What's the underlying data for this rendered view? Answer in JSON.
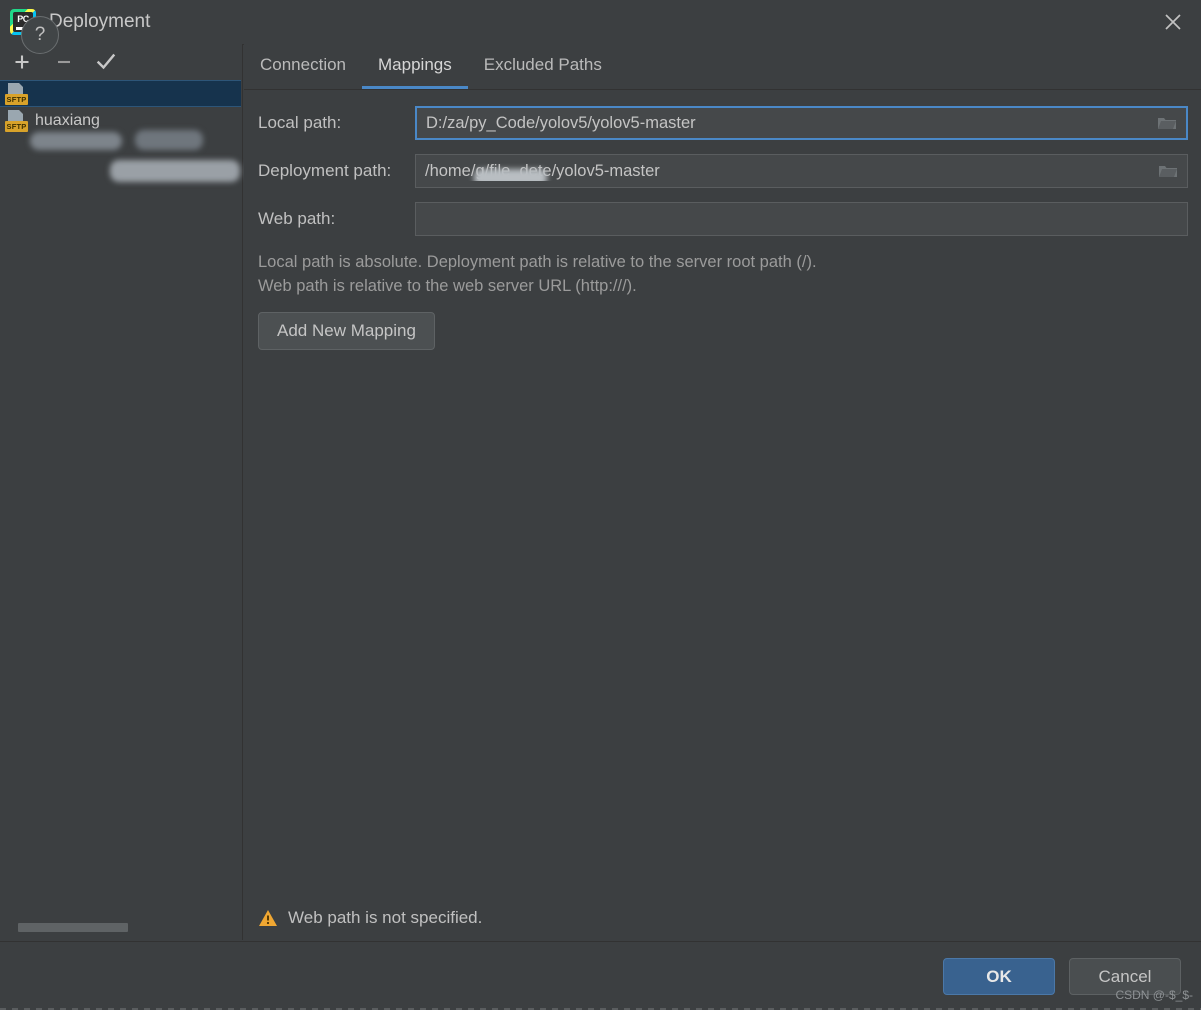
{
  "window": {
    "title": "Deployment",
    "logo_icon": "pycharm-logo",
    "close_icon": "close-icon"
  },
  "sidebar": {
    "toolbar": [
      {
        "name": "add",
        "icon": "plus-icon"
      },
      {
        "name": "remove",
        "icon": "minus-icon"
      },
      {
        "name": "set-default",
        "icon": "check-icon"
      }
    ],
    "items": [
      {
        "label": "",
        "badge": "SFTP",
        "icon": "sftp-server-icon",
        "selected": true
      },
      {
        "label": "huaxiang",
        "badge": "SFTP",
        "icon": "sftp-server-icon",
        "selected": false
      }
    ],
    "scrollbar": "horizontal-scrollbar"
  },
  "tabs": [
    {
      "label": "Connection",
      "active": false
    },
    {
      "label": "Mappings",
      "active": true
    },
    {
      "label": "Excluded Paths",
      "active": false
    }
  ],
  "form": {
    "local_path": {
      "label": "Local path:",
      "value": "D:/za/py_Code/yolov5/yolov5-master",
      "placeholder": "",
      "browse_icon": "folder-icon",
      "focused": true
    },
    "deployment_path": {
      "label": "Deployment path:",
      "value_prefix": "/home/",
      "value_suffix": "g/file_dete/yolov5-master",
      "placeholder": "",
      "browse_icon": "folder-icon",
      "focused": false
    },
    "web_path": {
      "label": "Web path:",
      "value": "",
      "placeholder": "",
      "focused": false
    }
  },
  "hint": {
    "line1": "Local path is absolute. Deployment path is relative to the server root path (/).",
    "line2": "Web path is relative to the web server URL (http:///)."
  },
  "add_mapping_button": "Add New Mapping",
  "status": {
    "warning_icon": "warning-triangle-icon",
    "warning_text": "Web path is not specified.",
    "warning_color": "#f0a732"
  },
  "footer": {
    "help_label": "?",
    "help_icon": "question-mark-icon",
    "ok_label": "OK",
    "cancel_label": "Cancel",
    "accent_color": "#39628f"
  },
  "watermark": "CSDN @-$_$-"
}
